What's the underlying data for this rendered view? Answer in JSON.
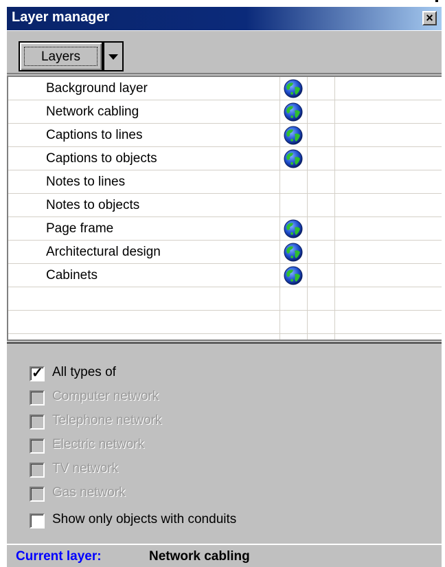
{
  "window": {
    "title": "Layer manager",
    "close_icon": "close-x-icon"
  },
  "toolbar": {
    "layers_label": "Layers",
    "dropdown_icon": "chevron-down-icon"
  },
  "layers": [
    {
      "name": "Background layer",
      "visible_icon": true
    },
    {
      "name": "Network cabling",
      "visible_icon": true
    },
    {
      "name": "Captions to lines",
      "visible_icon": true
    },
    {
      "name": "Captions to objects",
      "visible_icon": true
    },
    {
      "name": "Notes to lines",
      "visible_icon": false
    },
    {
      "name": "Notes to objects",
      "visible_icon": false
    },
    {
      "name": "Page frame",
      "visible_icon": true
    },
    {
      "name": "Architectural design",
      "visible_icon": true
    },
    {
      "name": "Cabinets",
      "visible_icon": true
    },
    {
      "name": "",
      "visible_icon": false
    },
    {
      "name": "",
      "visible_icon": false
    }
  ],
  "filters": {
    "all_types": {
      "label": "All types of",
      "checked": true,
      "enabled": true
    },
    "network_types": [
      {
        "label": "Computer network",
        "checked": false,
        "enabled": false
      },
      {
        "label": "Telephone network",
        "checked": false,
        "enabled": false
      },
      {
        "label": "Electric network",
        "checked": false,
        "enabled": false
      },
      {
        "label": "TV network",
        "checked": false,
        "enabled": false
      },
      {
        "label": "Gas network",
        "checked": false,
        "enabled": false
      }
    ],
    "conduits": {
      "label": "Show only objects with conduits",
      "checked": false,
      "enabled": true
    }
  },
  "status": {
    "label": "Current layer:",
    "value": "Network cabling"
  },
  "colors": {
    "title_bar": "#0a246a",
    "status_label": "#0000ff",
    "panel": "#c0c0c0"
  }
}
